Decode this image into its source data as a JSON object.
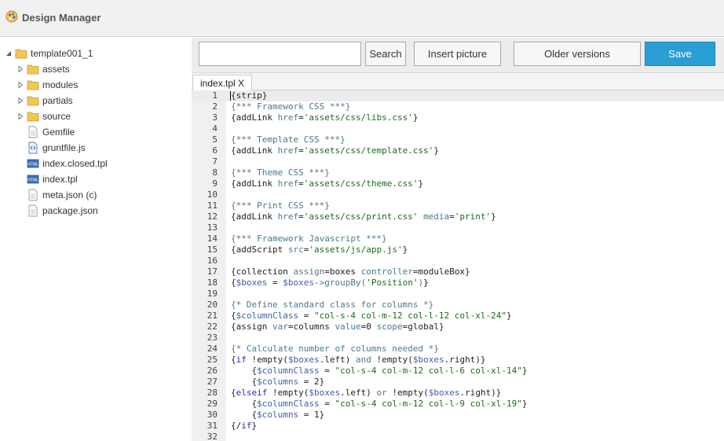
{
  "app": {
    "title": "Design Manager"
  },
  "sidebar": {
    "root": {
      "label": "template001_1"
    },
    "folders": [
      {
        "label": "assets"
      },
      {
        "label": "modules"
      },
      {
        "label": "partials"
      },
      {
        "label": "source"
      }
    ],
    "files": [
      {
        "label": "Gemfile",
        "icon": "text-file-icon"
      },
      {
        "label": "gruntfile.js",
        "icon": "script-file-icon"
      },
      {
        "label": "index.closed.tpl",
        "icon": "html-file-icon"
      },
      {
        "label": "index.tpl",
        "icon": "html-file-icon"
      },
      {
        "label": "meta.json (c)",
        "icon": "text-file-icon"
      },
      {
        "label": "package.json",
        "icon": "text-file-icon"
      }
    ]
  },
  "toolbar": {
    "search_value": "",
    "search_label": "Search",
    "insert_picture_label": "Insert picture",
    "older_versions_label": "Older versions",
    "save_label": "Save"
  },
  "tabs": [
    {
      "label": "index.tpl X"
    }
  ],
  "colors": {
    "save_bg": "#2a9fd6",
    "comment": "#4a7a8c",
    "attribute": "#4a7a8c",
    "string": "#1a6b1a",
    "variable": "#3a5fae",
    "keyword": "#2b2bb0"
  },
  "editor": {
    "active_line": 1,
    "lines": [
      [
        [
          "t",
          "{strip}"
        ]
      ],
      [
        [
          "c",
          "{*** Framework CSS ***}"
        ]
      ],
      [
        [
          "t",
          "{addLink "
        ],
        [
          "a",
          "href"
        ],
        [
          "t",
          "="
        ],
        [
          "s",
          "'assets/css/libs.css'"
        ],
        [
          "t",
          "}"
        ]
      ],
      [],
      [
        [
          "c",
          "{*** Template CSS ***}"
        ]
      ],
      [
        [
          "t",
          "{addLink "
        ],
        [
          "a",
          "href"
        ],
        [
          "t",
          "="
        ],
        [
          "s",
          "'assets/css/template.css'"
        ],
        [
          "t",
          "}"
        ]
      ],
      [],
      [
        [
          "c",
          "{*** Theme CSS ***}"
        ]
      ],
      [
        [
          "t",
          "{addLink "
        ],
        [
          "a",
          "href"
        ],
        [
          "t",
          "="
        ],
        [
          "s",
          "'assets/css/theme.css'"
        ],
        [
          "t",
          "}"
        ]
      ],
      [],
      [
        [
          "c",
          "{*** Print CSS ***}"
        ]
      ],
      [
        [
          "t",
          "{addLink "
        ],
        [
          "a",
          "href"
        ],
        [
          "t",
          "="
        ],
        [
          "s",
          "'assets/css/print.css'"
        ],
        [
          "t",
          " "
        ],
        [
          "a",
          "media"
        ],
        [
          "t",
          "="
        ],
        [
          "s",
          "'print'"
        ],
        [
          "t",
          "}"
        ]
      ],
      [],
      [
        [
          "c",
          "{*** Framework Javascript ***}"
        ]
      ],
      [
        [
          "t",
          "{addScript "
        ],
        [
          "a",
          "src"
        ],
        [
          "t",
          "="
        ],
        [
          "s",
          "'assets/js/app.js'"
        ],
        [
          "t",
          "}"
        ]
      ],
      [],
      [
        [
          "t",
          "{collection "
        ],
        [
          "a",
          "assign"
        ],
        [
          "t",
          "=boxes "
        ],
        [
          "a",
          "controller"
        ],
        [
          "t",
          "=moduleBox}"
        ]
      ],
      [
        [
          "t",
          "{"
        ],
        [
          "v",
          "$boxes"
        ],
        [
          "t",
          " = "
        ],
        [
          "v",
          "$boxes"
        ],
        [
          "a",
          "->groupBy("
        ],
        [
          "s",
          "'Position'"
        ],
        [
          "a",
          ")"
        ],
        [
          "t",
          "}"
        ]
      ],
      [],
      [
        [
          "c",
          "{* Define standard class for columns *}"
        ]
      ],
      [
        [
          "t",
          "{"
        ],
        [
          "v",
          "$columnClass"
        ],
        [
          "t",
          " = "
        ],
        [
          "s",
          "\"col-s-4 col-m-12 col-l-12 col-xl-24\""
        ],
        [
          "t",
          "}"
        ]
      ],
      [
        [
          "t",
          "{assign "
        ],
        [
          "a",
          "var"
        ],
        [
          "t",
          "=columns "
        ],
        [
          "a",
          "value"
        ],
        [
          "t",
          "=0 "
        ],
        [
          "a",
          "scope"
        ],
        [
          "t",
          "=global}"
        ]
      ],
      [],
      [
        [
          "c",
          "{* Calculate number of columns needed *}"
        ]
      ],
      [
        [
          "t",
          "{"
        ],
        [
          "k",
          "if"
        ],
        [
          "t",
          " !empty("
        ],
        [
          "v",
          "$boxes"
        ],
        [
          "t",
          ".left) "
        ],
        [
          "a",
          "and"
        ],
        [
          "t",
          " !empty("
        ],
        [
          "v",
          "$boxes"
        ],
        [
          "t",
          ".right)}"
        ]
      ],
      [
        [
          "t",
          "    {"
        ],
        [
          "v",
          "$columnClass"
        ],
        [
          "t",
          " = "
        ],
        [
          "s",
          "\"col-s-4 col-m-12 col-l-6 col-xl-14\""
        ],
        [
          "t",
          "}"
        ]
      ],
      [
        [
          "t",
          "    {"
        ],
        [
          "v",
          "$columns"
        ],
        [
          "t",
          " = 2}"
        ]
      ],
      [
        [
          "t",
          "{"
        ],
        [
          "k",
          "elseif"
        ],
        [
          "t",
          " !empty("
        ],
        [
          "v",
          "$boxes"
        ],
        [
          "t",
          ".left) "
        ],
        [
          "a",
          "or"
        ],
        [
          "t",
          " !empty("
        ],
        [
          "v",
          "$boxes"
        ],
        [
          "t",
          ".right)}"
        ]
      ],
      [
        [
          "t",
          "    {"
        ],
        [
          "v",
          "$columnClass"
        ],
        [
          "t",
          " = "
        ],
        [
          "s",
          "\"col-s-4 col-m-12 col-l-9 col-xl-19\""
        ],
        [
          "t",
          "}"
        ]
      ],
      [
        [
          "t",
          "    {"
        ],
        [
          "v",
          "$columns"
        ],
        [
          "t",
          " = 1}"
        ]
      ],
      [
        [
          "t",
          "{/"
        ],
        [
          "k",
          "if"
        ],
        [
          "t",
          "}"
        ]
      ],
      []
    ]
  }
}
